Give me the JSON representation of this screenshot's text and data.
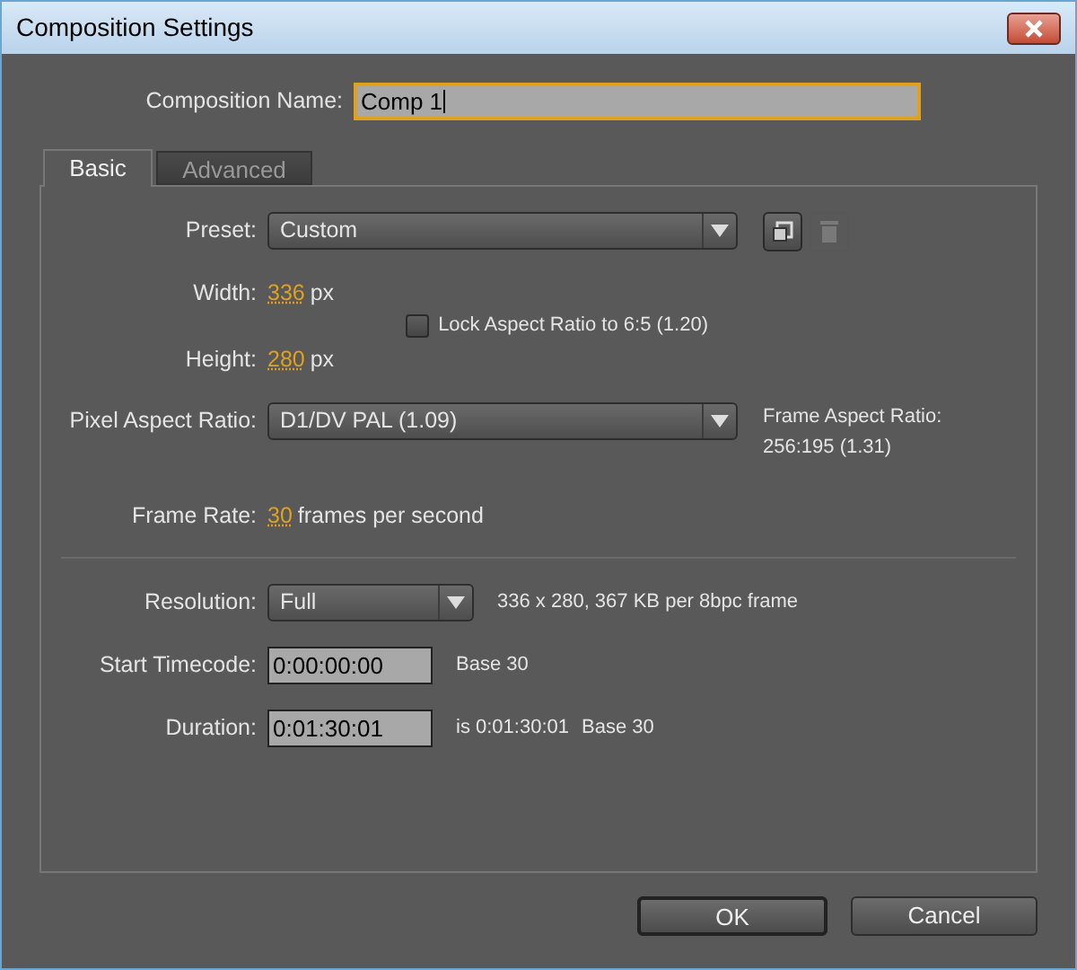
{
  "window": {
    "title": "Composition Settings"
  },
  "composition_name": {
    "label": "Composition Name:",
    "value": "Comp 1",
    "focused": true
  },
  "tabs": [
    {
      "label": "Basic",
      "selected": true
    },
    {
      "label": "Advanced",
      "selected": false
    }
  ],
  "preset": {
    "label": "Preset:",
    "value": "Custom"
  },
  "preset_buttons": [
    {
      "kind": "save",
      "disabled": false
    },
    {
      "kind": "delete",
      "disabled": true
    }
  ],
  "width": {
    "label": "Width:",
    "value": "336",
    "unit": "px"
  },
  "height": {
    "label": "Height:",
    "value": "280",
    "unit": "px"
  },
  "lock_aspect": {
    "label": "Lock Aspect Ratio to 6:5 (1.20)",
    "checked": false
  },
  "pixel_aspect_ratio": {
    "label": "Pixel Aspect Ratio:",
    "value": "D1/DV PAL (1.09)"
  },
  "frame_aspect_ratio": {
    "label": "Frame Aspect Ratio:",
    "value": "256:195 (1.31)"
  },
  "frame_rate": {
    "label": "Frame Rate:",
    "value": "30",
    "unit": "frames per second"
  },
  "resolution": {
    "label": "Resolution:",
    "value": "Full",
    "info": "336 x 280, 367 KB per 8bpc frame"
  },
  "start_timecode": {
    "label": "Start Timecode:",
    "value": "0:00:00:00",
    "note": "Base 30"
  },
  "duration": {
    "label": "Duration:",
    "value": "0:01:30:01",
    "equivalent": "is 0:01:30:01",
    "note": "Base 30"
  },
  "buttons": [
    {
      "label": "OK",
      "default": true
    },
    {
      "label": "Cancel",
      "default": false
    }
  ]
}
